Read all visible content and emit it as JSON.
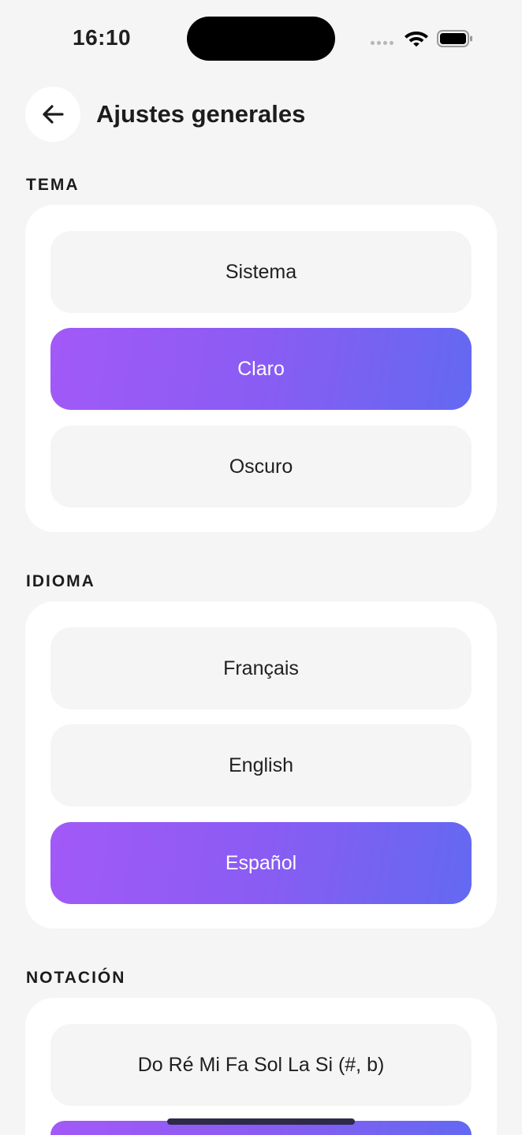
{
  "status_bar": {
    "time": "16:10"
  },
  "header": {
    "title": "Ajustes generales"
  },
  "sections": {
    "tema": {
      "label": "TEMA",
      "options": [
        "Sistema",
        "Claro",
        "Oscuro"
      ],
      "selected": "Claro"
    },
    "idioma": {
      "label": "IDIOMA",
      "options": [
        "Français",
        "English",
        "Español"
      ],
      "selected": "Español"
    },
    "notacion": {
      "label": "NOTACIÓN",
      "options": [
        "Do Ré Mi Fa Sol La Si (#, b)"
      ],
      "selected": ""
    }
  },
  "colors": {
    "accent_start": "#a259f7",
    "accent_end": "#6369f2",
    "background": "#f5f5f5",
    "card": "#ffffff"
  },
  "icons": {
    "back": "arrow-left-icon",
    "wifi": "wifi-icon",
    "battery": "battery-icon",
    "signal": "signal-dots-icon"
  }
}
